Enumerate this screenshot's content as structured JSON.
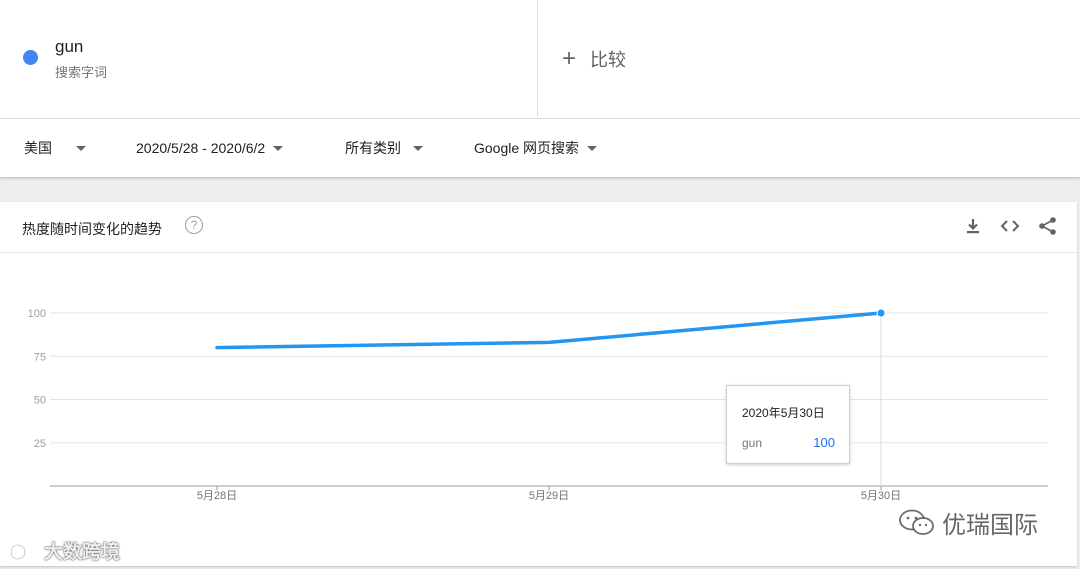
{
  "search_term": {
    "name": "gun",
    "type": "搜索字词",
    "color": "#4285f4"
  },
  "compare": {
    "plus": "+",
    "label": "比较"
  },
  "filters": {
    "region": "美国",
    "date_range": "2020/5/28 - 2020/6/2",
    "category": "所有类别",
    "search_type": "Google 网页搜索"
  },
  "card": {
    "title": "热度随时间变化的趋势",
    "help": "?",
    "icons": [
      "download-icon",
      "embed-icon",
      "share-icon"
    ]
  },
  "tooltip": {
    "date": "2020年5月30日",
    "term": "gun",
    "value": "100"
  },
  "watermarks": {
    "left": "大数跨境",
    "right": "优瑞国际"
  },
  "chart_data": {
    "type": "line",
    "x": [
      "5月28日",
      "5月29日",
      "5月30日"
    ],
    "series": [
      {
        "name": "gun",
        "values": [
          80,
          83,
          100
        ],
        "color": "#2196f3"
      }
    ],
    "yticks": [
      25,
      50,
      75,
      100
    ],
    "ylim": [
      0,
      100
    ],
    "grid": true,
    "highlight_index": 2
  }
}
